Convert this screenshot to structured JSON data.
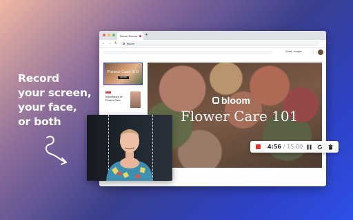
{
  "headline": [
    "Record",
    "your screen,",
    "your face,",
    "or both"
  ],
  "browser": {
    "tab_title": "Bloom Record",
    "url": "bloom",
    "google_links": [
      "Gmail",
      "Images"
    ],
    "sidebar": {
      "slide1_title": "Flower Care 101",
      "slide1_badge": "BLOOM",
      "slide2_text": "Importance of Flower Care"
    }
  },
  "hero": {
    "brand": "bloom",
    "title": "Flower Care 101"
  },
  "controls": {
    "elapsed": "4:56",
    "separator": "/",
    "limit": "15:00"
  },
  "colors": {
    "accent": "#3a4bd8",
    "stop": "#e4312f"
  },
  "icons": {
    "stop": "stop-square-icon",
    "pause": "pause-icon",
    "restart": "restart-icon",
    "delete": "trash-icon"
  }
}
